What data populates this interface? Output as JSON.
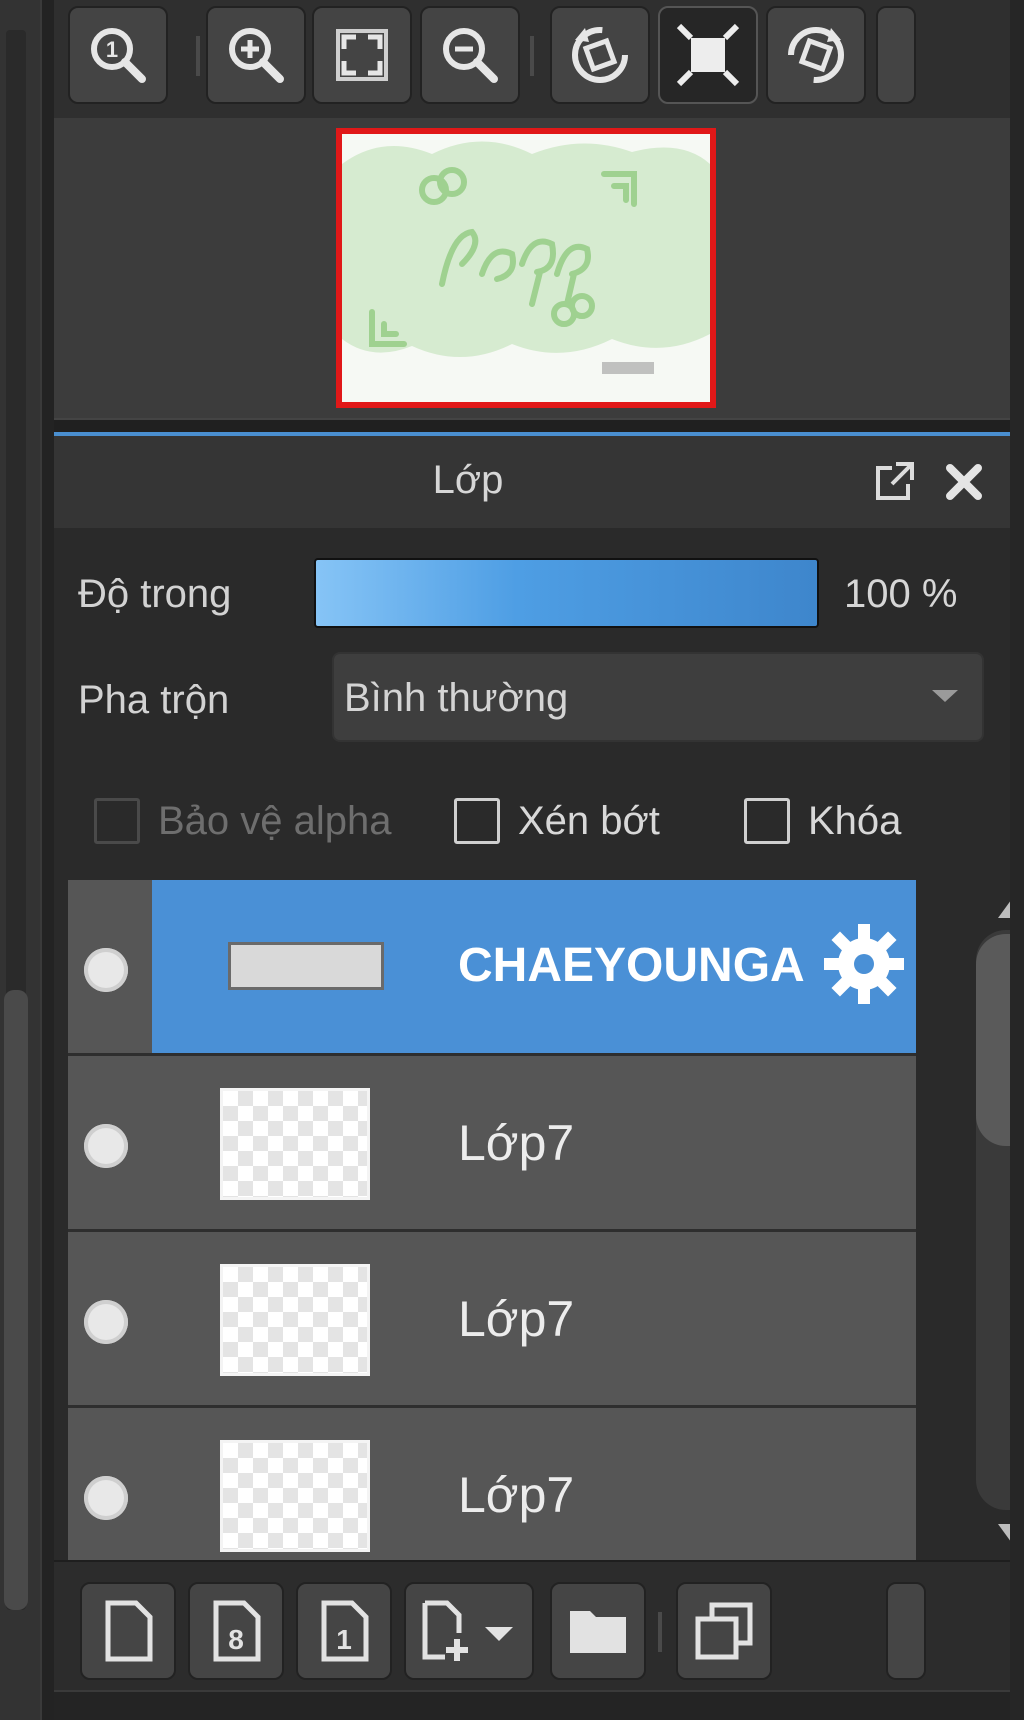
{
  "navigator": {
    "toolbar": [
      {
        "id": "actual-size",
        "icon": "zoom-actual-size-icon"
      },
      {
        "id": "zoom-in",
        "icon": "zoom-in-icon"
      },
      {
        "id": "fit",
        "icon": "fit-to-window-icon"
      },
      {
        "id": "zoom-out",
        "icon": "zoom-out-icon"
      },
      {
        "id": "rotate-left",
        "icon": "rotate-left-icon"
      },
      {
        "id": "reset-rotation",
        "icon": "reset-view-icon",
        "active": true
      },
      {
        "id": "rotate-right",
        "icon": "rotate-right-icon"
      }
    ],
    "thumbnail_frame_color": "#e01818"
  },
  "layer_panel": {
    "title": "Lớp",
    "opacity_label": "Độ trong",
    "opacity_value": "100 %",
    "opacity_fraction": 1.0,
    "blend_label": "Pha trộn",
    "blend_value": "Bình thường",
    "checkboxes": {
      "protect_alpha": {
        "label": "Bảo vệ alpha",
        "checked": false,
        "enabled": false
      },
      "clipping": {
        "label": "Xén bớt",
        "checked": false,
        "enabled": true
      },
      "lock": {
        "label": "Khóa",
        "checked": false,
        "enabled": true
      }
    },
    "layers": [
      {
        "name": "CHAEYOUNGA",
        "selected": true,
        "visible": true
      },
      {
        "name": "Lớp7",
        "selected": false,
        "visible": true
      },
      {
        "name": "Lớp7",
        "selected": false,
        "visible": true
      },
      {
        "name": "Lớp7",
        "selected": false,
        "visible": true
      }
    ],
    "selection_color": "#4a90d6"
  },
  "bottom_toolbar": [
    {
      "id": "new-layer",
      "icon": "new-layer-icon"
    },
    {
      "id": "new-8bit-layer",
      "icon": "new-8bit-layer-icon"
    },
    {
      "id": "new-1bit-layer",
      "icon": "new-1bit-layer-icon"
    },
    {
      "id": "add-layer-menu",
      "icon": "add-layer-dropdown-icon"
    },
    {
      "id": "new-folder",
      "icon": "folder-icon"
    },
    {
      "id": "duplicate",
      "icon": "duplicate-layer-icon"
    }
  ]
}
